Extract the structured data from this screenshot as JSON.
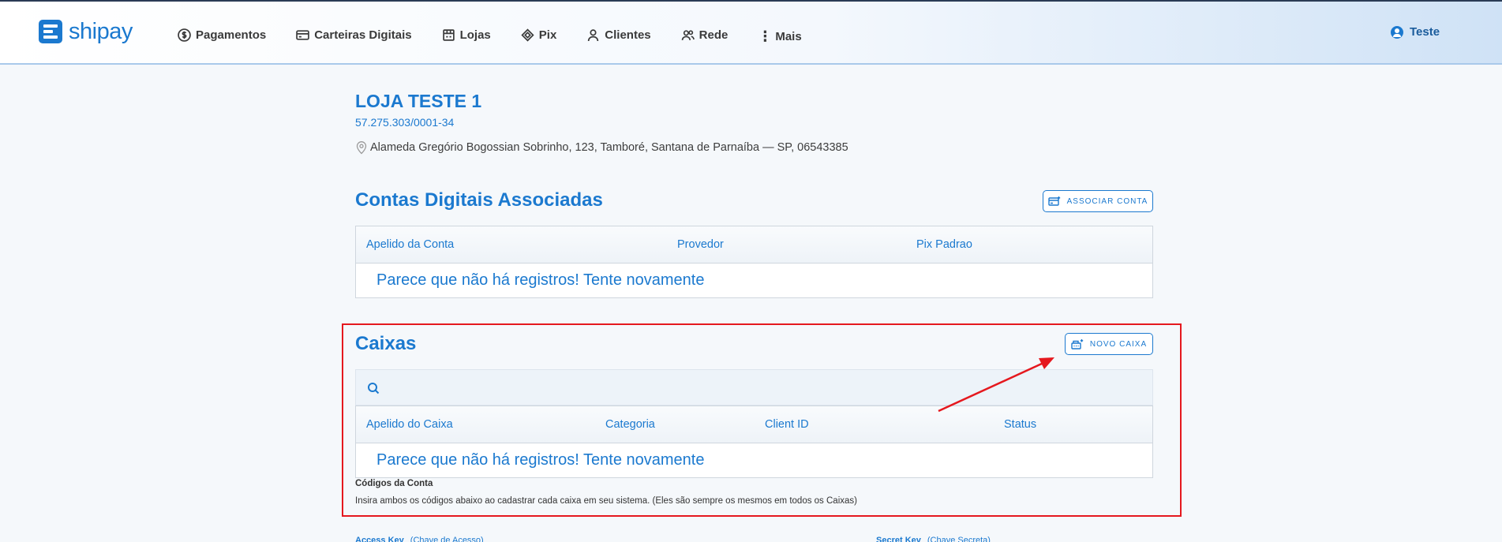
{
  "brand": {
    "name": "shipay",
    "color": "#1b79cf"
  },
  "nav": {
    "items": [
      {
        "label": "Pagamentos",
        "icon": "dollar-circle-icon"
      },
      {
        "label": "Carteiras Digitais",
        "icon": "card-icon"
      },
      {
        "label": "Lojas",
        "icon": "store-icon"
      },
      {
        "label": "Pix",
        "icon": "pix-icon"
      },
      {
        "label": "Clientes",
        "icon": "person-icon"
      },
      {
        "label": "Rede",
        "icon": "people-icon"
      }
    ],
    "more_label": "Mais"
  },
  "user": {
    "name": "Teste"
  },
  "store": {
    "title": "LOJA TESTE 1",
    "cnpj": "57.275.303/0001-34",
    "address": "Alameda Gregório Bogossian Sobrinho, 123, Tamboré, Santana de Parnaíba — SP, 06543385"
  },
  "accounts": {
    "title": "Contas Digitais Associadas",
    "button_label": "ASSOCIAR CONTA",
    "columns": [
      "Apelido da Conta",
      "Provedor",
      "Pix Padrao"
    ],
    "empty_message": "Parece que não há registros! Tente novamente"
  },
  "cashiers": {
    "title": "Caixas",
    "button_label": "NOVO CAIXA",
    "columns": [
      "Apelido do Caixa",
      "Categoria",
      "Client ID",
      "Status"
    ],
    "empty_message": "Parece que não há registros! Tente novamente"
  },
  "codes": {
    "title": "Códigos da Conta",
    "description": "Insira ambos os códigos abaixo ao cadastrar cada caixa em seu sistema. (Eles são sempre os mesmos em todos os Caixas)",
    "access_key_label": "Access Key",
    "access_key_hint": "(Chave de Acesso)",
    "secret_key_label": "Secret Key",
    "secret_key_hint": "(Chave Secreta)"
  },
  "annotation": {
    "highlight_color": "#e5181e"
  }
}
